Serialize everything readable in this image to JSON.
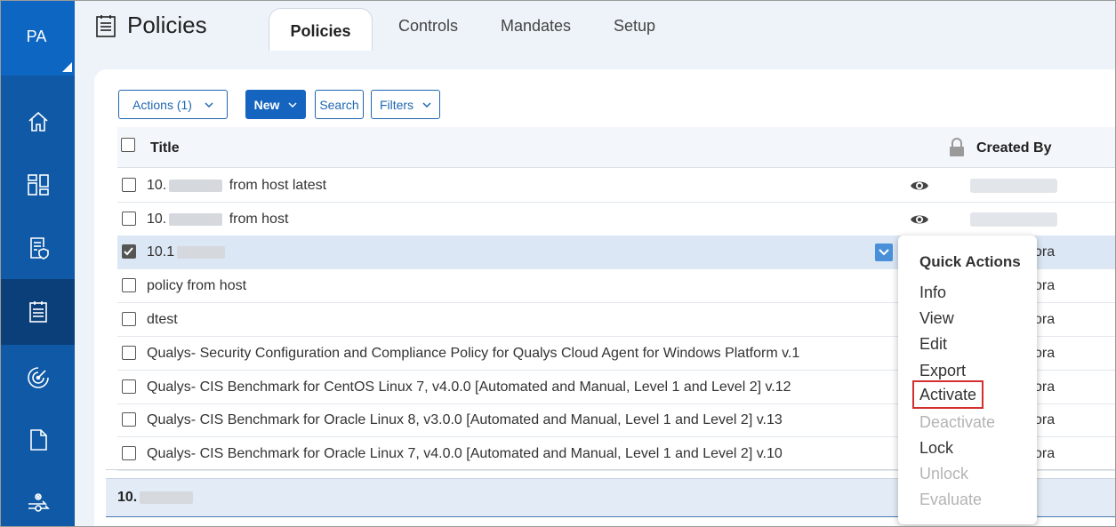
{
  "rail": {
    "badge": "PA",
    "items": [
      {
        "icon": "home-icon"
      },
      {
        "icon": "dashboard-icon"
      },
      {
        "icon": "policy-compliance-icon"
      },
      {
        "icon": "policies-icon",
        "active": true
      },
      {
        "icon": "scan-icon"
      },
      {
        "icon": "document-icon"
      },
      {
        "icon": "workflow-icon"
      }
    ]
  },
  "header": {
    "title": "Policies",
    "tabs": [
      {
        "label": "Policies",
        "active": true
      },
      {
        "label": "Controls"
      },
      {
        "label": "Mandates"
      },
      {
        "label": "Setup"
      }
    ]
  },
  "toolbar": {
    "actions_label": "Actions (1)",
    "new_label": "New",
    "search_label": "Search",
    "filters_label": "Filters"
  },
  "table": {
    "col_title": "Title",
    "col_created_by": "Created By",
    "rows": [
      {
        "prefix": "10.",
        "suffix": "from host latest",
        "checked": false,
        "creator": ""
      },
      {
        "prefix": "10.",
        "suffix": "from host",
        "checked": false,
        "creator": ""
      },
      {
        "prefix": "10.1",
        "suffix": "",
        "checked": true,
        "creator": "ora"
      },
      {
        "prefix": "policy from host",
        "suffix": "",
        "checked": false,
        "creator": "ora"
      },
      {
        "prefix": "dtest",
        "suffix": "",
        "checked": false,
        "creator": "ora"
      },
      {
        "prefix": "Qualys- Security Configuration and Compliance Policy for Qualys Cloud Agent for Windows Platform v.1",
        "suffix": "",
        "checked": false,
        "creator": "ora"
      },
      {
        "prefix": "Qualys- CIS Benchmark for CentOS Linux 7, v4.0.0 [Automated and Manual, Level 1 and Level 2] v.12",
        "suffix": "",
        "checked": false,
        "creator": "ora"
      },
      {
        "prefix": "Qualys- CIS Benchmark for Oracle Linux 8, v3.0.0 [Automated and Manual, Level 1 and Level 2] v.13",
        "suffix": "",
        "checked": false,
        "creator": "ora"
      },
      {
        "prefix": "Qualys- CIS Benchmark for Oracle Linux 7, v4.0.0 [Automated and Manual, Level 1 and Level 2] v.10",
        "suffix": "",
        "checked": false,
        "creator": "ora"
      }
    ]
  },
  "detail_bar": {
    "title": "10."
  },
  "quick_actions": {
    "title": "Quick Actions",
    "items": [
      {
        "label": "Info",
        "state": "enabled"
      },
      {
        "label": "View",
        "state": "enabled"
      },
      {
        "label": "Edit",
        "state": "enabled"
      },
      {
        "label": "Export",
        "state": "enabled"
      },
      {
        "label": "Activate",
        "state": "highlighted"
      },
      {
        "label": "Deactivate",
        "state": "disabled"
      },
      {
        "label": "Lock",
        "state": "enabled"
      },
      {
        "label": "Unlock",
        "state": "disabled"
      },
      {
        "label": "Evaluate",
        "state": "disabled"
      }
    ]
  },
  "colors": {
    "rail": "#0f59a6",
    "accent": "#1565c0",
    "selected_row": "#dbe7f4",
    "highlight_border": "#d32f2f"
  }
}
